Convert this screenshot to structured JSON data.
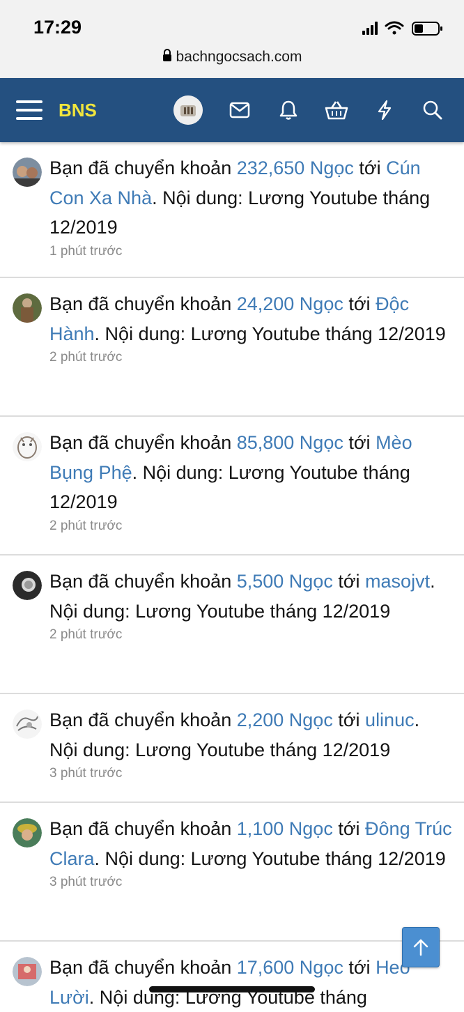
{
  "status_bar": {
    "time": "17:29",
    "url": "bachngocsach.com",
    "icons": [
      "signal-icon",
      "wifi-icon",
      "battery-icon"
    ]
  },
  "navbar": {
    "brand": "BNS",
    "background": "#245080",
    "brand_color": "#f2e63c",
    "icons": [
      "menu-icon",
      "avatar",
      "mail-icon",
      "bell-icon",
      "basket-icon",
      "lightning-icon",
      "search-icon"
    ]
  },
  "colors": {
    "link": "#3f7bb6",
    "text": "#141414",
    "muted": "#8a8a8a"
  },
  "feed": [
    {
      "prefix": "Bạn đã chuyển khoản ",
      "amount": "232,650 Ngọc",
      "mid": " tới ",
      "recipient": "Cún Con Xa Nhà",
      "suffix": ". Nội dung: Lương Youtube tháng 12/2019",
      "time": "1 phút trước"
    },
    {
      "prefix": "Bạn đã chuyển khoản ",
      "amount": "24,200 Ngọc",
      "mid": " tới ",
      "recipient": "Độc Hành",
      "suffix": ". Nội dung: Lương Youtube tháng 12/2019",
      "time": "2 phút trước"
    },
    {
      "prefix": "Bạn đã chuyển khoản ",
      "amount": "85,800 Ngọc",
      "mid": " tới ",
      "recipient": "Mèo Bụng Phệ",
      "suffix": ". Nội dung: Lương Youtube tháng 12/2019",
      "time": "2 phút trước"
    },
    {
      "prefix": "Bạn đã chuyển khoản ",
      "amount": "5,500 Ngọc",
      "mid": " tới ",
      "recipient": "masojvt",
      "suffix": ". Nội dung: Lương Youtube tháng 12/2019",
      "time": "2 phút trước"
    },
    {
      "prefix": "Bạn đã chuyển khoản ",
      "amount": "2,200 Ngọc",
      "mid": " tới ",
      "recipient": "ulinuc",
      "suffix": ". Nội dung: Lương Youtube tháng 12/2019",
      "time": "3 phút trước"
    },
    {
      "prefix": "Bạn đã chuyển khoản ",
      "amount": "1,100 Ngọc",
      "mid": " tới ",
      "recipient": "Đông Trúc Clara",
      "suffix": ". Nội dung: Lương Youtube tháng 12/2019",
      "time": "3 phút trước"
    },
    {
      "prefix": "Bạn đã chuyển khoản ",
      "amount": "17,600 Ngọc",
      "mid": " tới ",
      "recipient": "Heo Lười",
      "suffix": ". Nội dung: Lương Youtube tháng",
      "time": ""
    }
  ]
}
